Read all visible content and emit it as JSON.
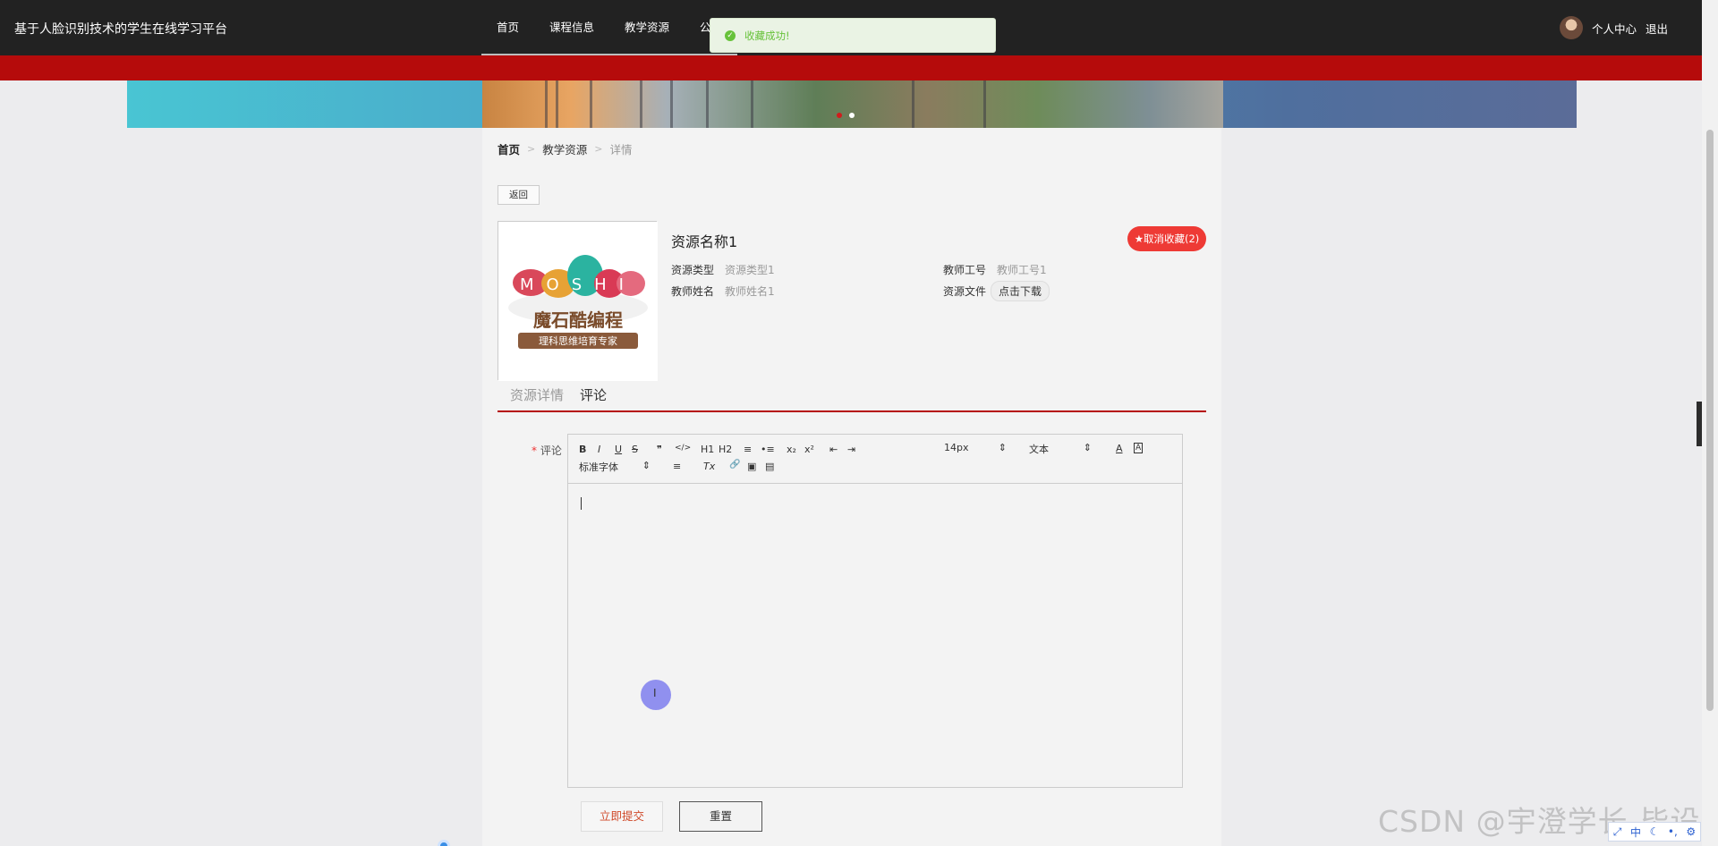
{
  "header": {
    "site_title": "基于人脸识别技术的学生在线学习平台",
    "nav": [
      "首页",
      "课程信息",
      "教学资源",
      "公告"
    ],
    "user_center": "个人中心",
    "logout": "退出"
  },
  "toast": {
    "message": "收藏成功!"
  },
  "breadcrumb": {
    "home": "首页",
    "section": "教学资源",
    "current": "详情",
    "sep": ">"
  },
  "actions": {
    "back": "返回",
    "favorite": "★取消收藏(2)"
  },
  "resource": {
    "name": "资源名称1",
    "fields": {
      "type_label": "资源类型",
      "type_value": "资源类型1",
      "teacher_no_label": "教师工号",
      "teacher_no_value": "教师工号1",
      "teacher_name_label": "教师姓名",
      "teacher_name_value": "教师姓名1",
      "file_label": "资源文件",
      "file_button": "点击下载"
    },
    "cover": {
      "logo_letters": "MOSHI",
      "logo_cn": "魔石酷编程",
      "logo_slogan": "理科思维培育专家"
    }
  },
  "tabs": [
    "资源详情",
    "评论"
  ],
  "active_tab": "评论",
  "comment_form": {
    "label": "评论",
    "required_mark": "*",
    "editor_toolbar": {
      "buttons": [
        "B",
        "I",
        "U",
        "S",
        "❞",
        "</>",
        "H1",
        "H2",
        "≡",
        "•≡",
        "x₂",
        "x²",
        "⇤",
        "⇥"
      ],
      "font_size": "14px",
      "heading": "文本",
      "font_family": "标准字体",
      "extra": [
        "A",
        "A",
        "≡",
        "Tx",
        "🔗",
        "▣",
        "▤"
      ]
    },
    "submit": "立即提交",
    "reset": "重置"
  },
  "watermark": "CSDN @宇澄学长-毕设",
  "ime": {
    "mode": "中"
  },
  "colors": {
    "accent_red": "#b50b0b",
    "fav_button": "#ee3a35",
    "topbar": "#222222",
    "toast_text": "#67c23a"
  }
}
